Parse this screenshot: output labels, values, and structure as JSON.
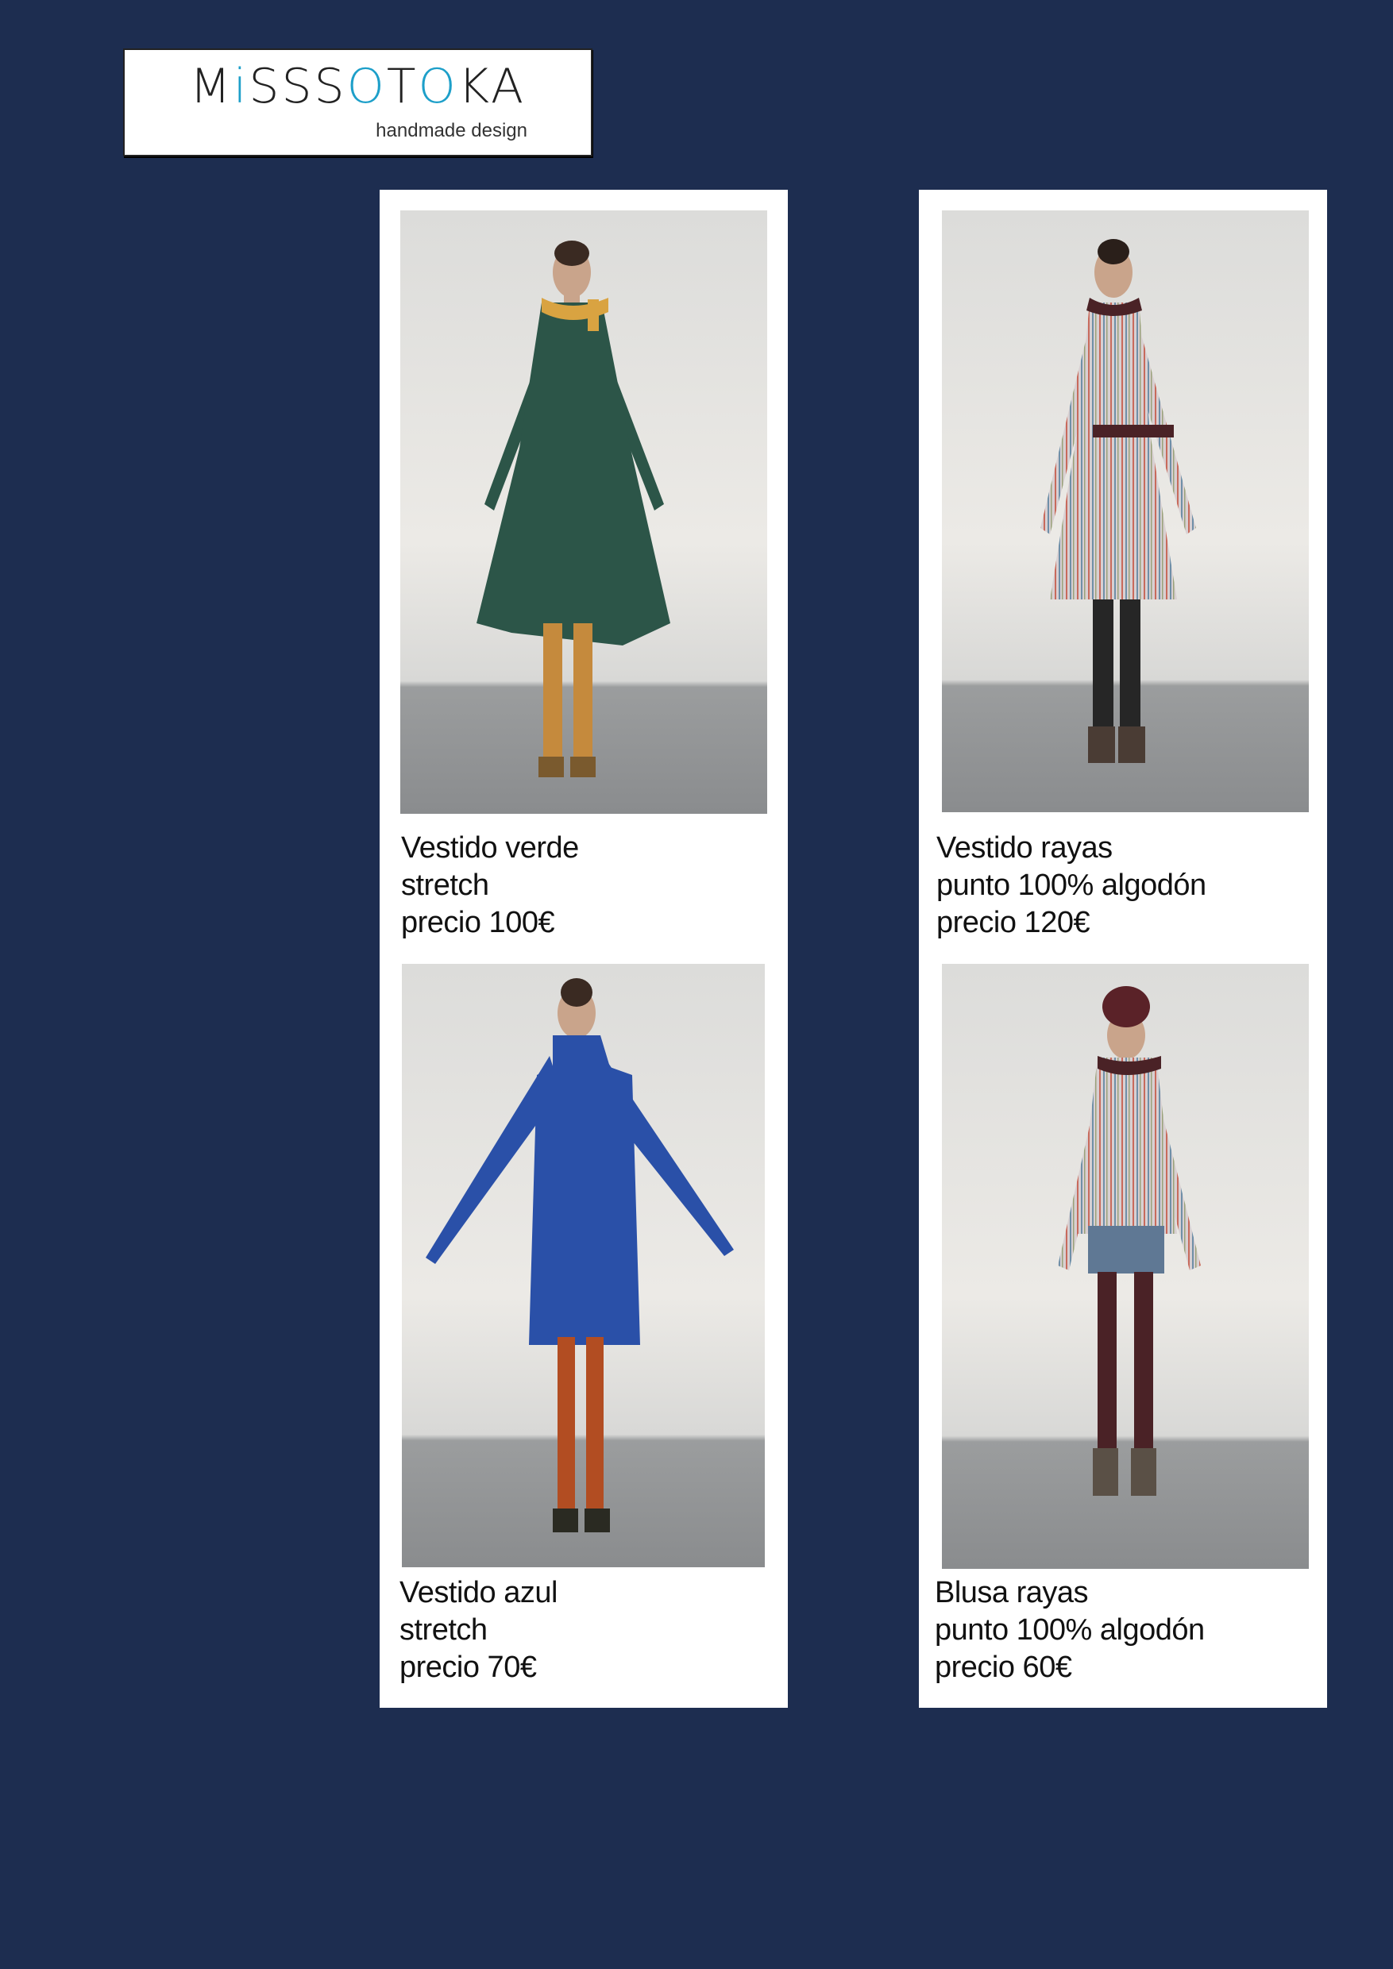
{
  "brand": {
    "logo_text": "MiSSSOTOKA",
    "tagline": "handmade design",
    "colors": {
      "background": "#1d2d50",
      "accent": "#1d9fc9"
    }
  },
  "products": [
    {
      "name": "Vestido verde",
      "material": "stretch",
      "price": "precio 100€",
      "garment_color": "#2c5548",
      "legwear_color": "#c58a3d",
      "pattern": "solid"
    },
    {
      "name": "Vestido rayas",
      "material": "punto 100% algodón",
      "price": "precio 120€",
      "garment_color": "#cfc6c8",
      "legwear_color": "#262626",
      "pattern": "stripes"
    },
    {
      "name": "Vestido azul",
      "material": "stretch",
      "price": "precio 70€",
      "garment_color": "#2a50a8",
      "legwear_color": "#b24d22",
      "pattern": "solid"
    },
    {
      "name": "Blusa rayas",
      "material": "punto 100% algodón",
      "price": "precio 60€",
      "garment_color": "#cfc6c8",
      "legwear_color": "#4a2226",
      "pattern": "stripes"
    }
  ]
}
